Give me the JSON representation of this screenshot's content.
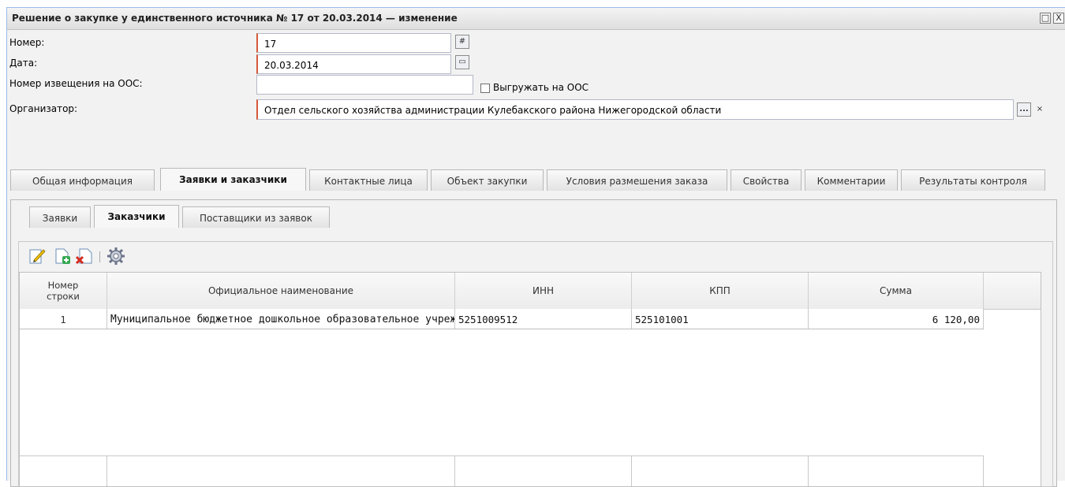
{
  "window": {
    "title": "Решение о закупке у единственного источника № 17 от 20.03.2014 — изменение",
    "maximize_glyph": "□",
    "close_glyph": "X"
  },
  "form": {
    "number_label": "Номер:",
    "number_value": "17",
    "date_label": "Дата:",
    "date_value": "20.03.2014",
    "notice_label": "Номер извещения на ООС:",
    "notice_value": "",
    "export_label": "Выгружать на ООС",
    "organizer_label": "Организатор:",
    "organizer_value": "Отдел сельского хозяйства администрации Кулебакского района Нижегородской области",
    "ellipsis_glyph": "...",
    "clear_glyph": "×"
  },
  "tabs": [
    "Общая информация",
    "Заявки и заказчики",
    "Контактные лица",
    "Объект закупки",
    "Условия размешения заказа",
    "Свойства",
    "Комментарии",
    "Результаты контроля"
  ],
  "subtabs": [
    "Заявки",
    "Заказчики",
    "Поставщики из заявок"
  ],
  "grid": {
    "columns": [
      "Номер строки",
      "Официальное наименование",
      "ИНН",
      "КПП",
      "Сумма"
    ],
    "rows": [
      [
        "1",
        "Муниципальное бюджетное дошкольное образовательное учреждение",
        "5251009512",
        "525101001",
        "6 120,00"
      ]
    ]
  },
  "colors": {
    "accent_border": "#99bbe8",
    "required_marker": "#d4583a"
  }
}
